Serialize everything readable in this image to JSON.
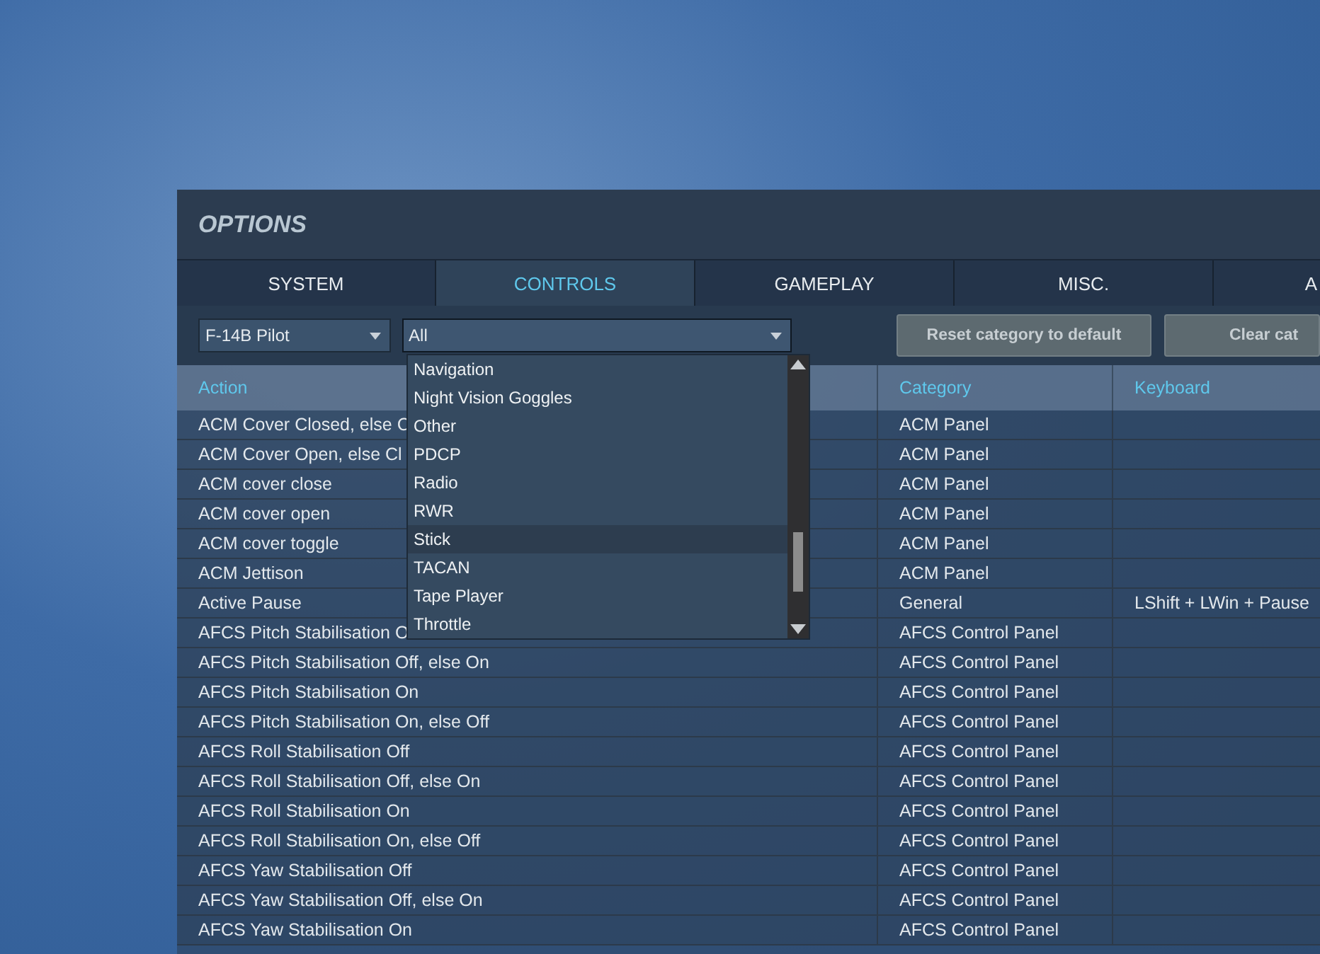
{
  "window": {
    "title": "OPTIONS"
  },
  "tabs": [
    {
      "label": "SYSTEM",
      "selected": false
    },
    {
      "label": "CONTROLS",
      "selected": true
    },
    {
      "label": "GAMEPLAY",
      "selected": false
    },
    {
      "label": "MISC.",
      "selected": false
    },
    {
      "label": "A",
      "selected": false
    }
  ],
  "toolbar": {
    "aircraft_select": {
      "value": "F-14B Pilot"
    },
    "category_select": {
      "value": "All",
      "expanded": true
    },
    "buttons": [
      "Reset category to default",
      "Clear cat"
    ]
  },
  "dropdown": {
    "items": [
      {
        "label": "Navigation",
        "selected": false
      },
      {
        "label": "Night Vision Goggles",
        "selected": false
      },
      {
        "label": "Other",
        "selected": false
      },
      {
        "label": "PDCP",
        "selected": false
      },
      {
        "label": "Radio",
        "selected": false
      },
      {
        "label": "RWR",
        "selected": false
      },
      {
        "label": "Stick",
        "selected": true
      },
      {
        "label": "TACAN",
        "selected": false
      },
      {
        "label": "Tape Player",
        "selected": false
      },
      {
        "label": "Throttle",
        "selected": false
      }
    ]
  },
  "table": {
    "columns": [
      "Action",
      "Category",
      "Keyboard"
    ],
    "rows": [
      {
        "action": "ACM Cover Closed, else C",
        "category": "ACM Panel",
        "keyboard": ""
      },
      {
        "action": "ACM Cover Open, else Cl",
        "category": "ACM Panel",
        "keyboard": ""
      },
      {
        "action": "ACM cover close",
        "category": "ACM Panel",
        "keyboard": ""
      },
      {
        "action": "ACM cover open",
        "category": "ACM Panel",
        "keyboard": ""
      },
      {
        "action": "ACM cover toggle",
        "category": "ACM Panel",
        "keyboard": ""
      },
      {
        "action": "ACM Jettison",
        "category": "ACM Panel",
        "keyboard": ""
      },
      {
        "action": "Active Pause",
        "category": "General",
        "keyboard": "LShift + LWin + Pause"
      },
      {
        "action": "AFCS Pitch Stabilisation O",
        "category": "AFCS Control Panel",
        "keyboard": ""
      },
      {
        "action": "AFCS Pitch Stabilisation Off, else On",
        "category": "AFCS Control Panel",
        "keyboard": ""
      },
      {
        "action": "AFCS Pitch Stabilisation On",
        "category": "AFCS Control Panel",
        "keyboard": ""
      },
      {
        "action": "AFCS Pitch Stabilisation On, else Off",
        "category": "AFCS Control Panel",
        "keyboard": ""
      },
      {
        "action": "AFCS Roll Stabilisation Off",
        "category": "AFCS Control Panel",
        "keyboard": ""
      },
      {
        "action": "AFCS Roll Stabilisation Off, else On",
        "category": "AFCS Control Panel",
        "keyboard": ""
      },
      {
        "action": "AFCS Roll Stabilisation On",
        "category": "AFCS Control Panel",
        "keyboard": ""
      },
      {
        "action": "AFCS Roll Stabilisation On, else Off",
        "category": "AFCS Control Panel",
        "keyboard": ""
      },
      {
        "action": "AFCS Yaw Stabilisation Off",
        "category": "AFCS Control Panel",
        "keyboard": ""
      },
      {
        "action": "AFCS Yaw Stabilisation Off, else On",
        "category": "AFCS Control Panel",
        "keyboard": ""
      },
      {
        "action": "AFCS Yaw Stabilisation On",
        "category": "AFCS Control Panel",
        "keyboard": ""
      }
    ]
  }
}
